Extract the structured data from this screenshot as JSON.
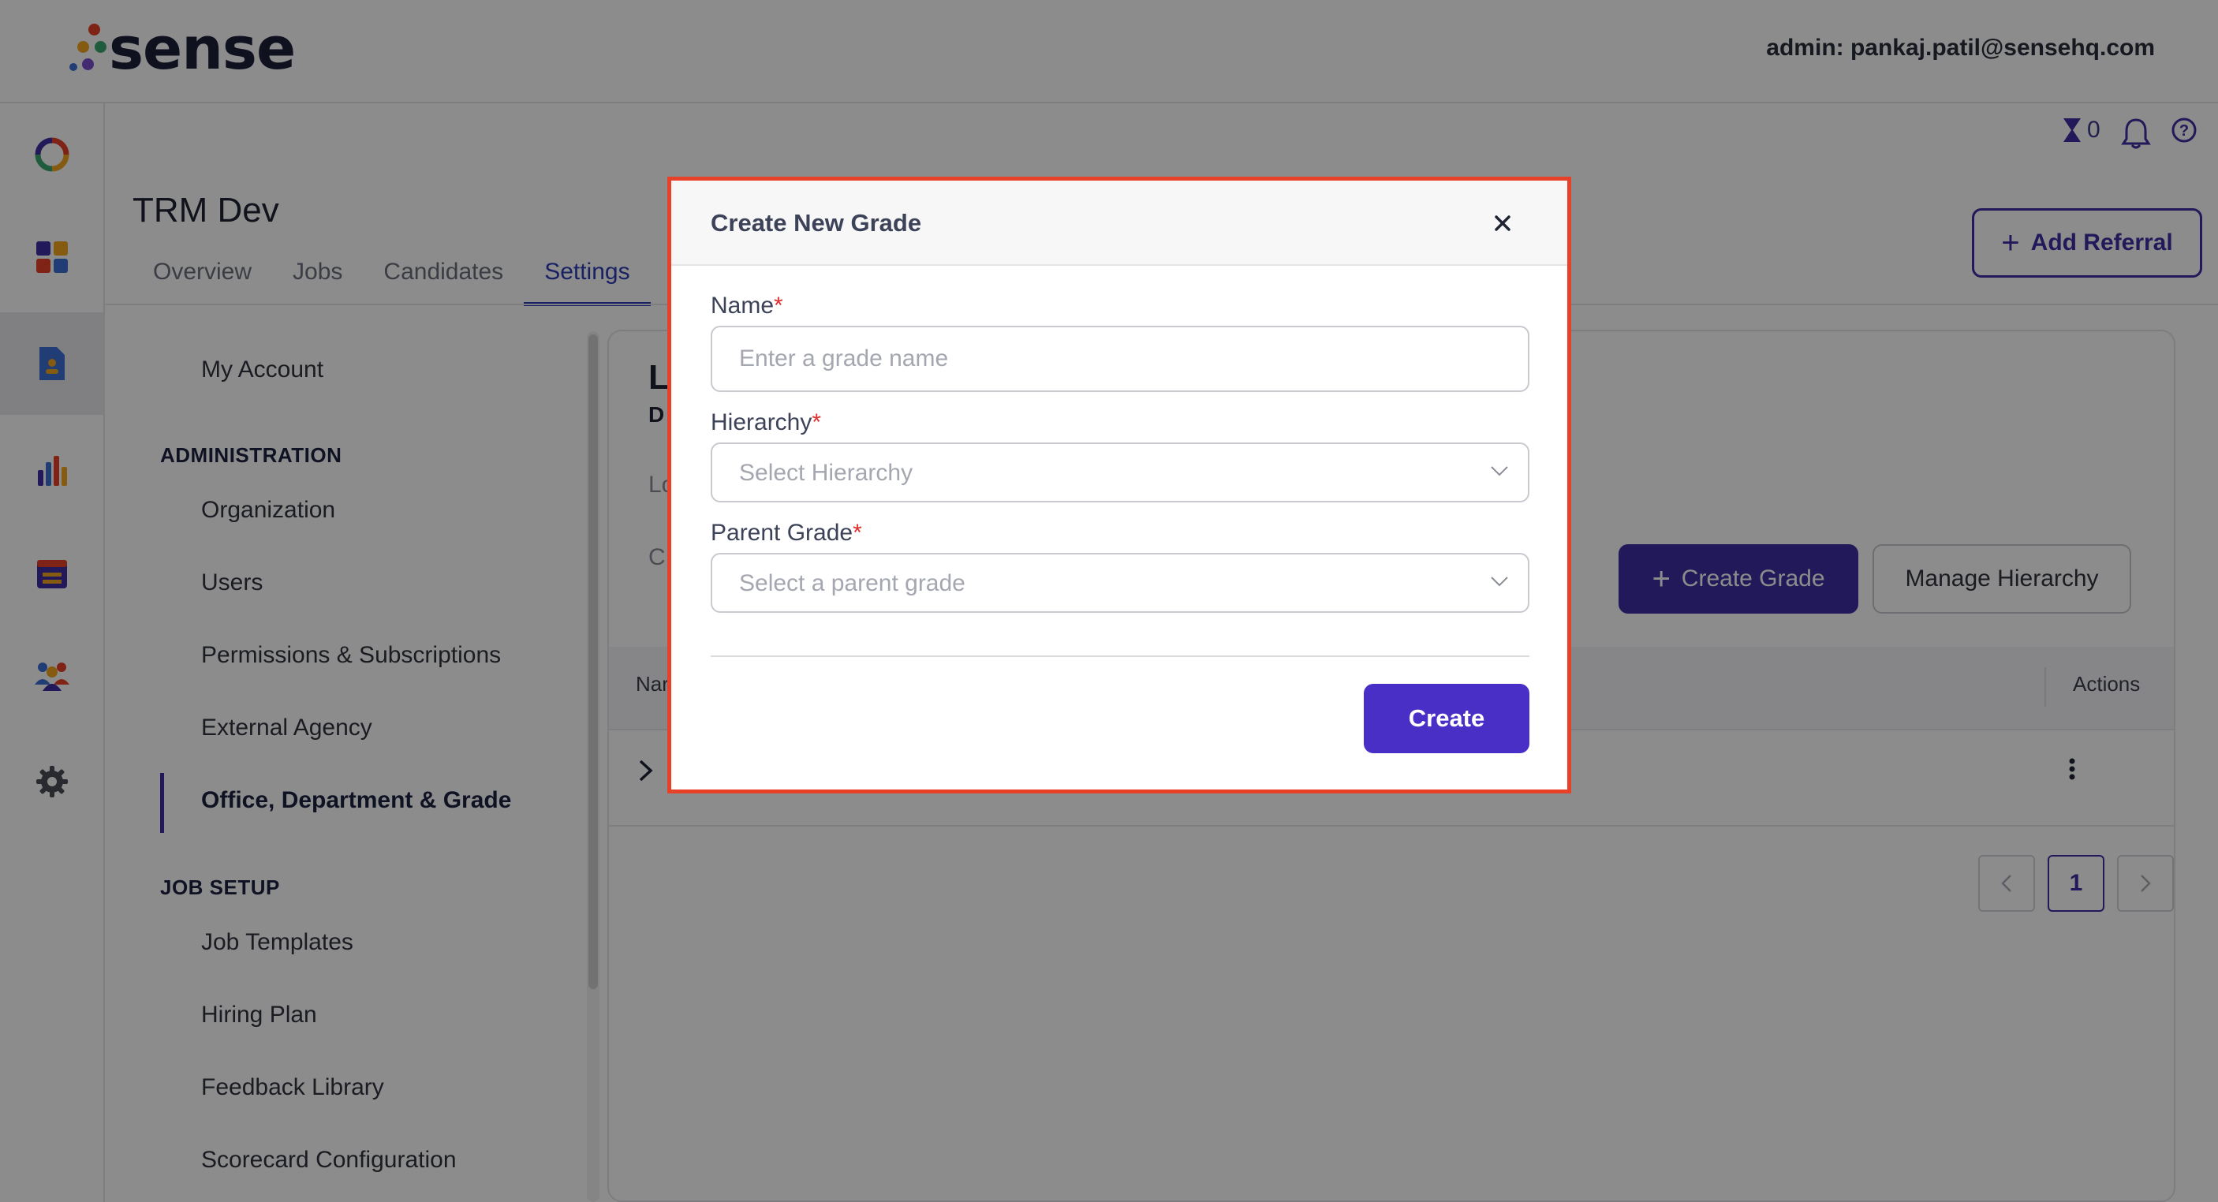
{
  "app": {
    "logo_text": "sense",
    "admin_email": "admin: pankaj.patil@sensehq.com"
  },
  "utility": {
    "hourglass_count": "0"
  },
  "project": {
    "title": "TRM Dev",
    "tabs": [
      {
        "label": "Overview"
      },
      {
        "label": "Jobs"
      },
      {
        "label": "Candidates"
      },
      {
        "label": "Settings"
      }
    ],
    "add_referral_label": "Add Referral"
  },
  "settings_nav": {
    "my_account": "My Account",
    "admin_section": "ADMINISTRATION",
    "admin_items": [
      "Organization",
      "Users",
      "Permissions & Subscriptions",
      "External Agency",
      "Office, Department & Grade"
    ],
    "job_setup_section": "JOB SETUP",
    "job_items": [
      "Job Templates",
      "Hiring Plan",
      "Feedback Library",
      "Scorecard Configuration"
    ]
  },
  "main": {
    "heading_fragment": "L",
    "subheading_fragment": "D",
    "row_fragment_1": "Lo",
    "row_fragment_2": "C",
    "create_grade_label": "Create Grade",
    "manage_hierarchy_label": "Manage Hierarchy",
    "table_name_header": "Nar",
    "table_actions_header": "Actions",
    "current_page": "1"
  },
  "modal": {
    "title": "Create New Grade",
    "name_label": "Name",
    "name_placeholder": "Enter a grade name",
    "name_value": "",
    "hierarchy_label": "Hierarchy",
    "hierarchy_placeholder": "Select Hierarchy",
    "parent_label": "Parent Grade",
    "parent_placeholder": "Select a parent grade",
    "required_mark": "*",
    "create_label": "Create"
  },
  "colors": {
    "brand": "#3d2fa3",
    "modal_create": "#4a2fc7",
    "modal_border": "#e8412a",
    "required": "#e02d2d"
  },
  "icons": [
    "sense-logo-dots",
    "analytics-ring-icon",
    "dashboard-grid-icon",
    "document-icon",
    "bar-chart-icon",
    "calendar-icon",
    "people-icon",
    "gear-icon",
    "hourglass-icon",
    "bell-icon",
    "help-icon",
    "plus-icon",
    "close-icon",
    "chevron-down-icon",
    "chevron-right-icon",
    "kebab-icon",
    "chevron-left-icon"
  ]
}
